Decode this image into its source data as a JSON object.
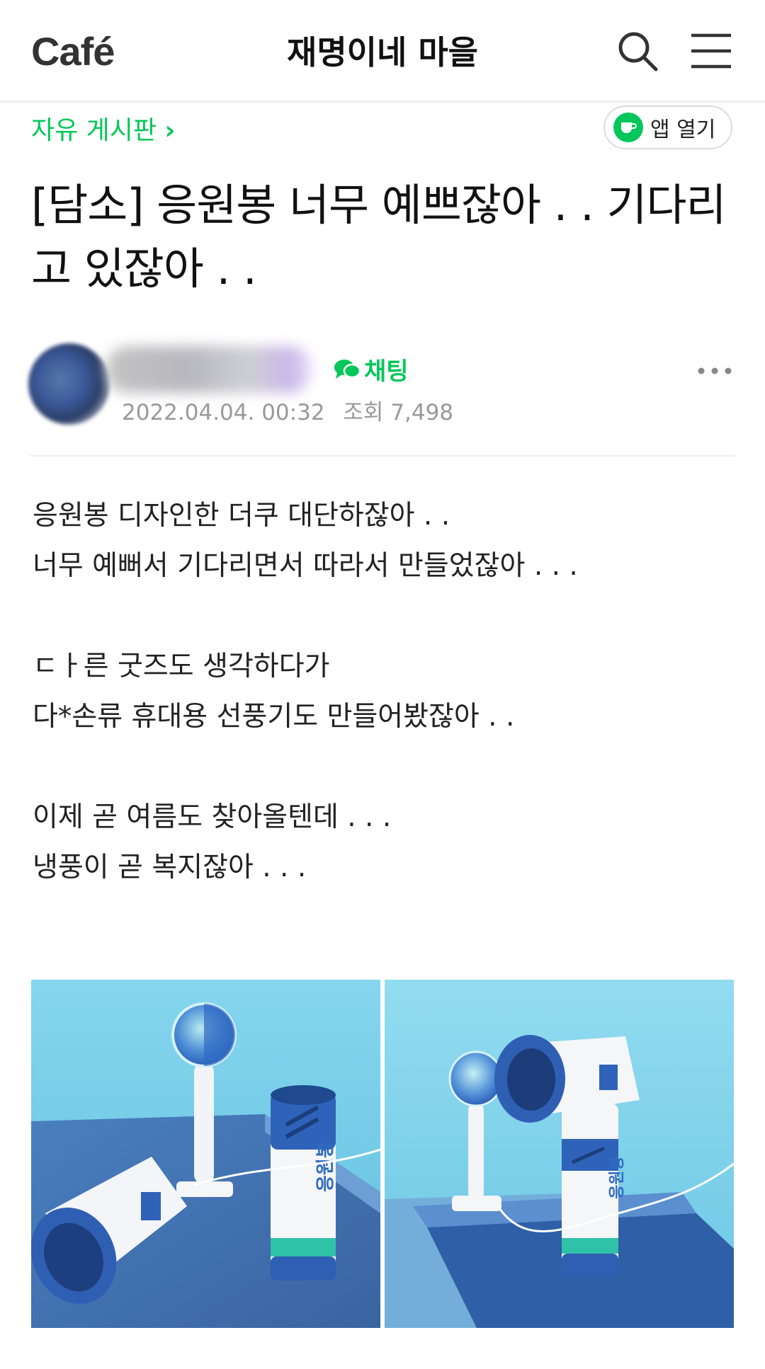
{
  "header": {
    "logo": "Café",
    "cafe_name": "재명이네 마을"
  },
  "board": {
    "name": "자유 게시판",
    "chevron": "›",
    "app_open_label": "앱 열기"
  },
  "post": {
    "title": "[담소] 응원봉 너무 예쁘잖아 . . 기다리고 있잖아 . .",
    "chat_label": "채팅",
    "date": "2022.04.04. 00:32",
    "views": "조회 7,498",
    "body": {
      "p1": "응원봉 디자인한 더쿠 대단하잖아 . .",
      "p2": "너무 예뻐서 기다리면서 따라서 만들었잖아 . . .",
      "p3": "ㄷㅏ른 굿즈도 생각하다가",
      "p4": "다*손류 휴대용 선풍기도 만들어봤잖아 . .",
      "p5": "이제 곧 여름도 찾아올텐데 . . .",
      "p6": "냉풍이 곧 복지잖아 . . ."
    }
  },
  "icons": {
    "search": "search-icon",
    "menu": "hamburger-menu-icon",
    "app": "cafe-cup-icon",
    "chat": "chat-bubble-icon",
    "more": "more-dots-icon"
  },
  "colors": {
    "brand_green": "#03c75a",
    "photo_sky": "#7fd0ea",
    "product_blue": "#2b5fb8"
  }
}
